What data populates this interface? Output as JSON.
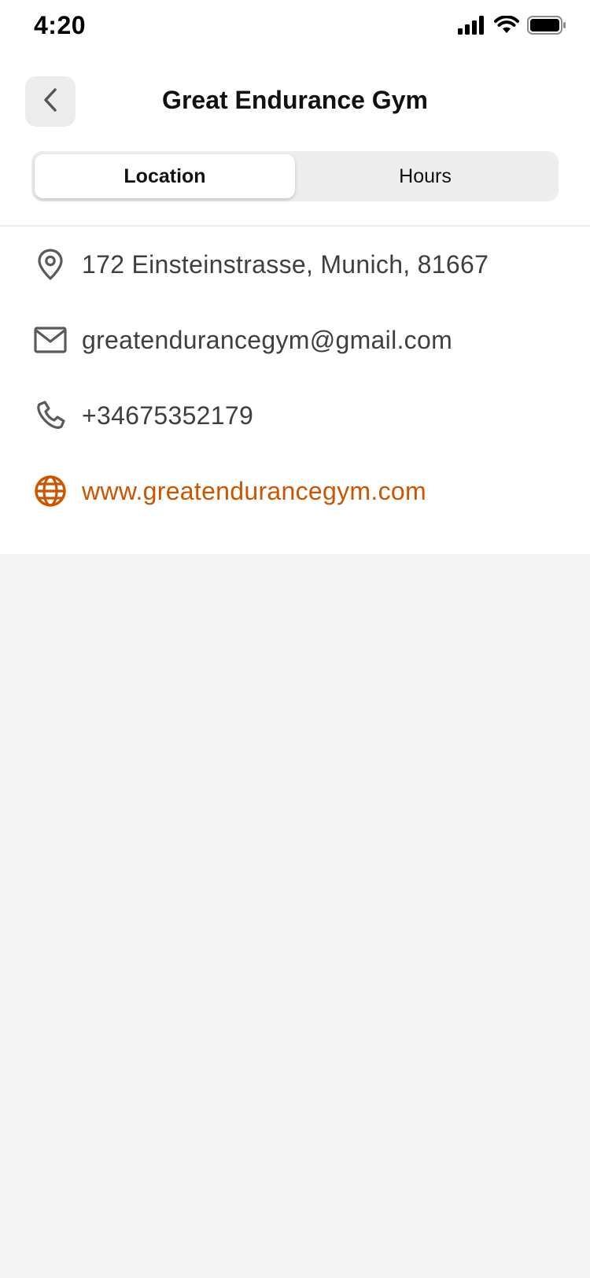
{
  "status_bar": {
    "time": "4:20",
    "icons": [
      "cellular-signal-icon",
      "wifi-icon",
      "battery-icon"
    ]
  },
  "header": {
    "back_icon": "chevron-left-icon",
    "title": "Great Endurance Gym"
  },
  "tabs": [
    {
      "label": "Location",
      "selected": true
    },
    {
      "label": "Hours",
      "selected": false
    }
  ],
  "contact": {
    "address": {
      "icon": "location-pin-icon",
      "text": "172  Einsteinstrasse, Munich,  81667"
    },
    "email": {
      "icon": "mail-icon",
      "text": "greatendurancegym@gmail.com"
    },
    "phone": {
      "icon": "phone-icon",
      "text": "+34675352179"
    },
    "website": {
      "icon": "globe-icon",
      "text": "www.greatendurancegym.com"
    }
  },
  "colors": {
    "accent": "#cc5500",
    "background": "#f3f3f3",
    "surface": "#ffffff",
    "icon_gray": "#5a5a5a"
  }
}
